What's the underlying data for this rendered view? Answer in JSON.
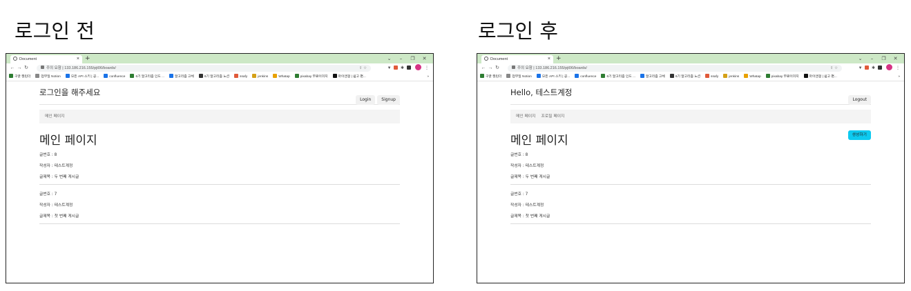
{
  "panels": [
    {
      "heading": "로그인 전",
      "browser": {
        "tab_title": "Document",
        "url_prefix": "주의 요함 |",
        "url": "133.186.216.155/pjt06/boards/",
        "bookmarks": [
          "구글 캘린더",
          "업무일 Notion",
          "모든 API 스키 | 공...",
          "confluence",
          "6기 알고리즘 인드 ...",
          "알고리즘 고체",
          "6기 알고리즘 노션",
          "ssafy",
          "jenkins",
          "Whatap",
          "pixabay 무료이미지",
          "마이앤걸 | 쉽고 편..."
        ]
      },
      "header_text": "로그인을 해주세요",
      "header_buttons": [
        "Login",
        "Signup"
      ],
      "subnav": [
        "메인 페이지"
      ],
      "main_title": "메인 페이지",
      "create_button": "",
      "posts": [
        {
          "num_label": "글번호 :",
          "num": "8",
          "author_label": "작성자 :",
          "author": "테스트계정",
          "title_label": "글제목 :",
          "title": "두 번째 게시글"
        },
        {
          "num_label": "글번호 :",
          "num": "7",
          "author_label": "작성자 :",
          "author": "테스트계정",
          "title_label": "글제목 :",
          "title": "첫 번째 게시글"
        }
      ]
    },
    {
      "heading": "로그인 후",
      "browser": {
        "tab_title": "Document",
        "url_prefix": "주의 요함 |",
        "url": "133.186.216.155/pjt06/boards/",
        "bookmarks": [
          "구글 캘린더",
          "업무일 Notion",
          "모든 API 스키 | 공...",
          "confluence",
          "6기 알고리즘 인드 ...",
          "알고리즘 고체",
          "6기 알고리즘 노션",
          "ssafy",
          "jenkins",
          "Whatap",
          "pixabay 무료이미지",
          "마이앤걸 | 쉽고 편..."
        ]
      },
      "header_text": "Hello, 테스트계정",
      "header_buttons": [
        "Logout"
      ],
      "subnav": [
        "메인 페이지",
        "프로필 페이지"
      ],
      "main_title": "메인 페이지",
      "create_button": "생성하기",
      "posts": [
        {
          "num_label": "글번호 :",
          "num": "8",
          "author_label": "작성자 :",
          "author": "테스트계정",
          "title_label": "글제목 :",
          "title": "두 번째 게시글"
        },
        {
          "num_label": "글번호 :",
          "num": "7",
          "author_label": "작성자 :",
          "author": "테스트계정",
          "title_label": "글제목 :",
          "title": "첫 번째 게시글"
        }
      ]
    }
  ],
  "colors": {
    "chrome_tabbar": "#cde8c6",
    "link": "#0d6efd",
    "create_button": "#0dcaf0"
  }
}
